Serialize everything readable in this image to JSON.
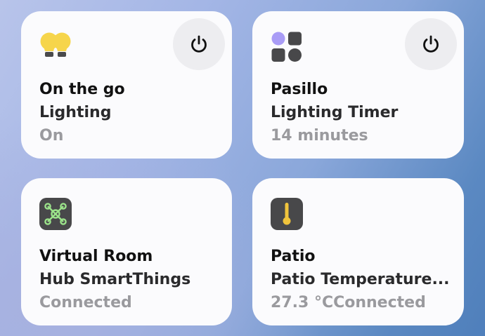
{
  "cards": [
    {
      "title": "On the go",
      "subtitle": "Lighting",
      "status": "On",
      "icon": "light-bulbs-icon",
      "has_power": true
    },
    {
      "title": "Pasillo",
      "subtitle": "Lighting Timer",
      "status": "14 minutes",
      "icon": "shapes-icon",
      "has_power": true
    },
    {
      "title": "Virtual Room",
      "subtitle": "Hub SmartThings",
      "status": "Connected",
      "icon": "hub-icon",
      "has_power": false
    },
    {
      "title": "Patio",
      "subtitle": "Patio Temperature...",
      "status": "27.3 °CConnected",
      "icon": "thermometer-icon",
      "has_power": false
    }
  ],
  "colors": {
    "card_background": "#fbfbfd",
    "power_button": "#ededf0",
    "bulb_yellow": "#f6d54b",
    "shape_purple": "#a99cf6",
    "hub_green": "#9be38a",
    "thermometer_yellow": "#f0c43c",
    "status_gray": "#9a9a9e"
  }
}
